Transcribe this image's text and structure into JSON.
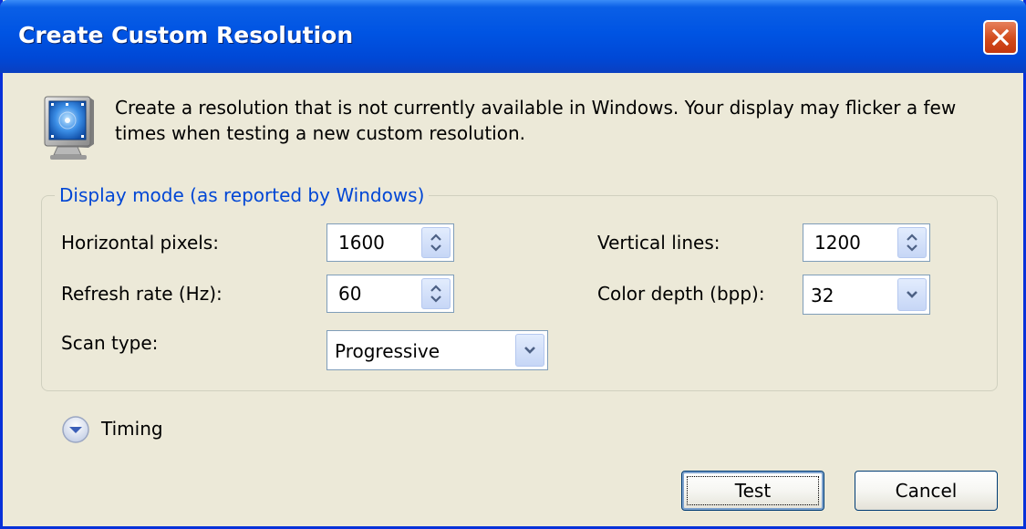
{
  "window": {
    "title": "Create Custom Resolution"
  },
  "description": "Create a resolution that is not currently available in Windows. Your display may flicker a few times when testing a new custom resolution.",
  "display_mode": {
    "legend": "Display mode (as reported by Windows)",
    "horizontal_pixels": {
      "label": "Horizontal pixels:",
      "value": "1600"
    },
    "refresh_rate": {
      "label": "Refresh rate (Hz):",
      "value": "60"
    },
    "scan_type": {
      "label": "Scan type:",
      "value": "Progressive"
    },
    "vertical_lines": {
      "label": "Vertical lines:",
      "value": "1200"
    },
    "color_depth": {
      "label": "Color depth (bpp):",
      "value": "32"
    }
  },
  "timing": {
    "label": "Timing"
  },
  "buttons": {
    "test": "Test",
    "cancel": "Cancel"
  },
  "icons": {
    "close": "close-icon",
    "monitor": "monitor-icon",
    "spin": "spin-arrows-icon",
    "dropdown": "chevron-down-icon",
    "expand": "expand-circle-icon"
  },
  "colors": {
    "titlebar": "#0054e3",
    "window_bg": "#ece9d8",
    "legend_text": "#0046d5",
    "close_button": "#d24a1b"
  }
}
